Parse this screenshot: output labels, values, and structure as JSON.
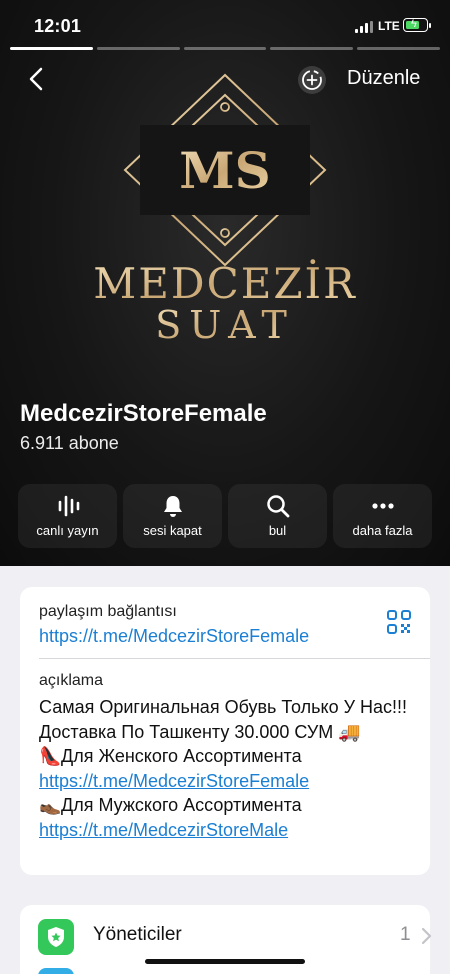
{
  "status": {
    "time": "12:01",
    "network": "LTE"
  },
  "header": {
    "edit_label": "Düzenle",
    "logo_initials": "MS",
    "logo_line1": "MEDCEZİR",
    "logo_line2": "SUAT",
    "channel_name": "MedcezirStoreFemale",
    "subscribers": "6.911 abone"
  },
  "actions": [
    {
      "label": "canlı yayın",
      "icon": "live-stream-icon"
    },
    {
      "label": "sesi kapat",
      "icon": "bell-icon"
    },
    {
      "label": "bul",
      "icon": "search-icon"
    },
    {
      "label": "daha fazla",
      "icon": "more-icon"
    }
  ],
  "info": {
    "share_label": "paylaşım bağlantısı",
    "share_link": "https://t.me/MedcezirStoreFemale",
    "desc_label": "açıklama",
    "desc_line1": "Самая Оригинальная Обувь Только У Нас!!!",
    "desc_line2": "Доставка По Ташкенту 30.000 СУМ",
    "desc_emoji_truck": "🚚",
    "desc_emoji_heel": "👠",
    "desc_line3": "Для Женского Ассортимента",
    "desc_link1": "https://t.me/MedcezirStoreFemale",
    "desc_emoji_shoe": "👞",
    "desc_line4": "Для Мужского Ассортимента",
    "desc_link2": "https://t.me/MedcezirStoreMale"
  },
  "admins": {
    "label": "Yöneticiler",
    "count": "1"
  },
  "colors": {
    "link": "#1b7fd3",
    "gold": "#d8bf92",
    "admin_green": "#34c759"
  }
}
